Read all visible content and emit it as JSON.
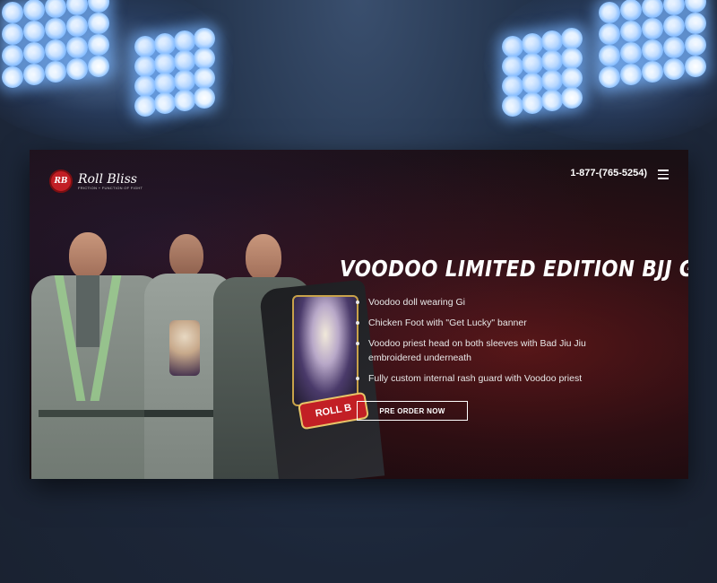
{
  "brand": {
    "name": "Roll Bliss",
    "badge": "RB",
    "tagline": "FRICTION + FUNCTION OF FIGHT"
  },
  "header": {
    "phone": "1-877-(765-5254)",
    "menu_icon": "hamburger-menu-icon"
  },
  "hero": {
    "title": "VOODOO LIMITED EDITION BJJ GI",
    "features": [
      "Voodoo doll wearing Gi",
      "Chicken Foot with \"Get Lucky\" banner",
      "Voodoo priest head on both sleeves with Bad Jiu Jiu embroidered underneath",
      "Fully custom internal rash guard with Voodoo priest"
    ],
    "cta_label": "PRE ORDER NOW",
    "jacket_print": "ROLL B"
  },
  "colors": {
    "accent_red": "#c21f25",
    "background_dark": "#130a0e",
    "text_light": "#e8e8e8"
  }
}
